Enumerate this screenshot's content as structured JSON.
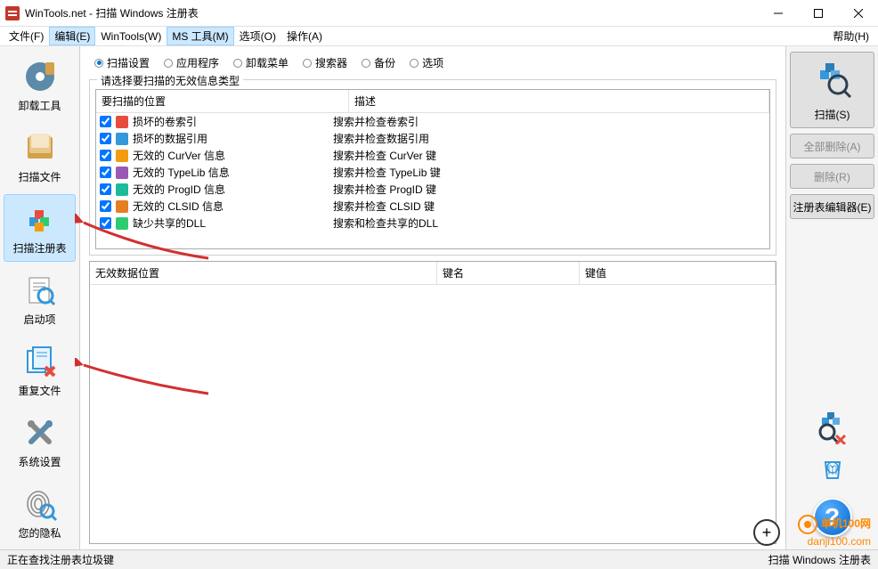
{
  "title": "WinTools.net - 扫描 Windows 注册表",
  "menu": {
    "file": "文件(F)",
    "edit": "编辑(E)",
    "wintools": "WinTools(W)",
    "mstools": "MS 工具(M)",
    "options": "选项(O)",
    "operate": "操作(A)",
    "help": "帮助(H)"
  },
  "sidebar": {
    "uninstall": "卸载工具",
    "scanfiles": "扫描文件",
    "scanreg": "扫描注册表",
    "startup": "启动项",
    "dupfiles": "重复文件",
    "sysset": "系统设置",
    "privacy": "您的隐私"
  },
  "tabs": {
    "scanset": "扫描设置",
    "apps": "应用程序",
    "uninstmenu": "卸载菜单",
    "searcher": "搜索器",
    "backup": "备份",
    "opts": "选项"
  },
  "group_legend": "请选择要扫描的无效信息类型",
  "scan_cols": {
    "loc": "要扫描的位置",
    "desc": "描述"
  },
  "scan_rows": [
    {
      "loc": "损坏的卷索引",
      "desc": "搜索并检查卷索引",
      "color": "#e74c3c"
    },
    {
      "loc": "损坏的数据引用",
      "desc": "搜索并检查数据引用",
      "color": "#3498db"
    },
    {
      "loc": "无效的 CurVer 信息",
      "desc": "搜索并检查 CurVer 键",
      "color": "#f39c12"
    },
    {
      "loc": "无效的 TypeLib 信息",
      "desc": "搜索并检查 TypeLib 键",
      "color": "#9b59b6"
    },
    {
      "loc": "无效的 ProgID 信息",
      "desc": "搜索并检查 ProgID 键",
      "color": "#1abc9c"
    },
    {
      "loc": "无效的 CLSID 信息",
      "desc": "搜索并检查 CLSID 键",
      "color": "#e67e22"
    },
    {
      "loc": "缺少共享的DLL",
      "desc": "搜索和检查共享的DLL",
      "color": "#2ecc71"
    }
  ],
  "results_cols": {
    "loc": "无效数据位置",
    "key": "键名",
    "val": "键值"
  },
  "right": {
    "scan": "扫描(S)",
    "delall": "全部删除(A)",
    "del": "删除(R)",
    "regedit": "注册表编辑器(E)"
  },
  "status": {
    "left": "正在查找注册表垃圾键",
    "right": "扫描 Windows 注册表"
  },
  "watermark": {
    "brand": "单机100网",
    "url": "danji100.com"
  }
}
